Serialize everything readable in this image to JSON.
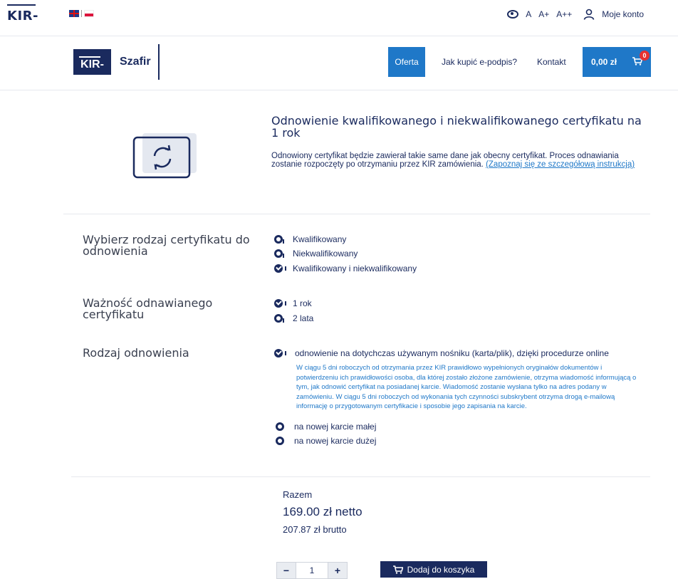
{
  "topbar": {
    "logo_text": "KIR",
    "lang_uk": "English",
    "lang_pl": "Polski",
    "font_sizes": [
      "A",
      "A+",
      "A++"
    ],
    "account_label": "Moje konto"
  },
  "nav": {
    "brand_kir": "KIR",
    "brand_name": "Szafir",
    "items": [
      "Oferta",
      "Jak kupić e-podpis?",
      "Kontakt"
    ],
    "cart_amount": "0,00 zł",
    "cart_count": "0"
  },
  "product": {
    "title": "Odnowienie kwalifikowanego i niekwalifikowanego certyfikatu na 1 rok",
    "description": "Odnowiony certyfikat będzie zawierał takie same dane jak obecny certyfikat. Proces odnawiania zostanie rozpoczęty po otrzymaniu przez KIR zamówienia.",
    "link_text": "(Zapoznaj się ze szczegółową instrukcją)"
  },
  "sections": {
    "cert_type": {
      "label": "Wybierz rodzaj certyfikatu do odnowienia",
      "options": [
        "Kwalifikowany",
        "Niekwalifikowany",
        "Kwalifikowany i niekwalifikowany"
      ],
      "selected": "Kwalifikowany i niekwalifikowany"
    },
    "validity": {
      "label": "Ważność odnawianego certyfikatu",
      "options": [
        "1 rok",
        "2 lata"
      ],
      "selected": "1 rok"
    },
    "renewal": {
      "label": "Rodzaj odnowienia",
      "options": [
        "odnowienie na dotychczas używanym nośniku (karta/plik), dzięki procedurze online",
        "na nowej karcie małej",
        "na nowej karcie dużej"
      ],
      "selected": "odnowienie na dotychczas używanym nośniku (karta/plik), dzięki procedurze online",
      "info": "W ciągu 5 dni roboczych od otrzymania przez KIR prawidłowo wypełnionych oryginałów dokumentów i potwierdzeniu ich prawidłowości osoba, dla której zostało złożone zamówienie, otrzyma wiadomość informującą o tym, jak odnowić certyfikat na posiadanej karcie. Wiadomość zostanie wysłana tylko na adres podany w zamówieniu. W ciągu 5 dni roboczych od wykonania tych czynności subskrybent otrzyma drogą e-mailową informację o przygotowanym certyfikacie i sposobie jego zapisania na karcie."
    }
  },
  "totals": {
    "label": "Razem",
    "netto": "169.00 zł netto",
    "brutto": "207.87 zł brutto"
  },
  "cart_form": {
    "minus": "−",
    "quantity": "1",
    "plus": "+",
    "add_label": "Dodaj do koszyka"
  }
}
